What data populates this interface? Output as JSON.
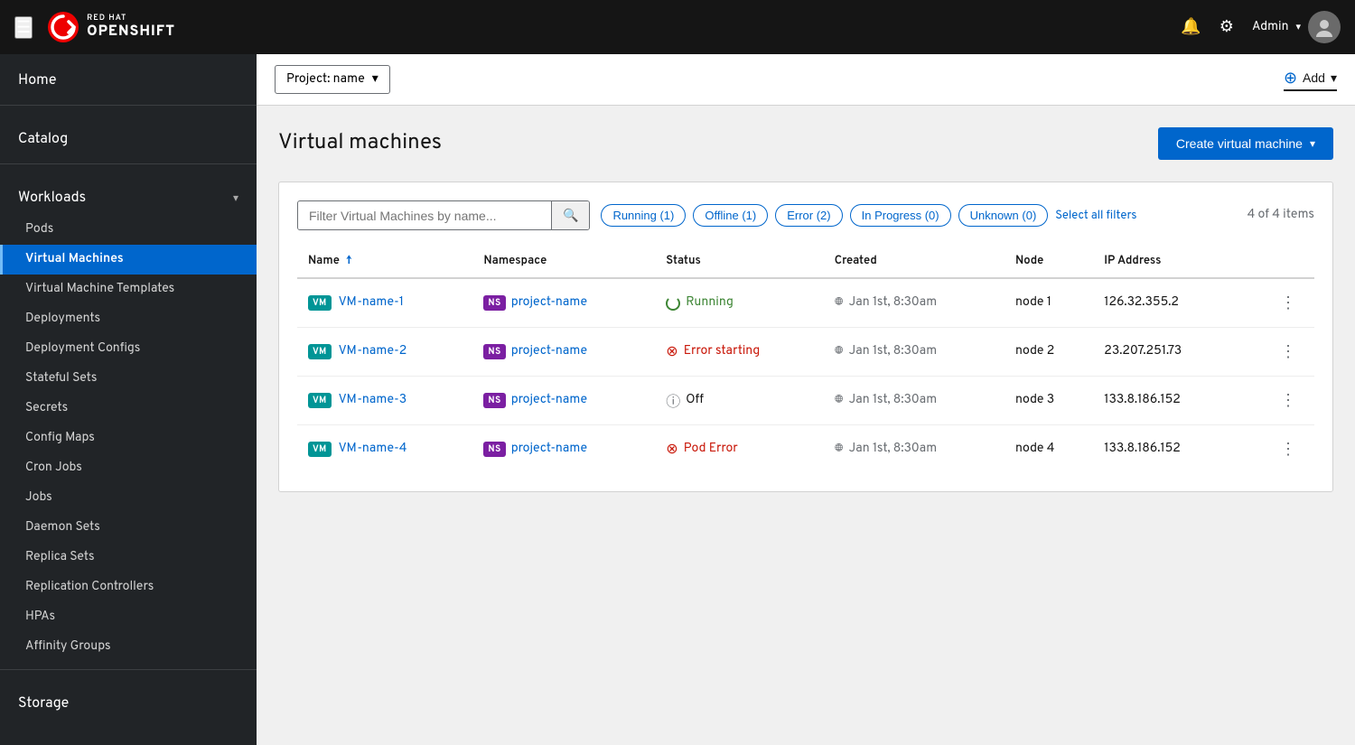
{
  "topnav": {
    "logo_text": "OPENSHIFT",
    "logo_subtext": "RED HAT",
    "user_label": "Admin",
    "user_chevron": "▾"
  },
  "sidebar": {
    "home_label": "Home",
    "catalog_label": "Catalog",
    "workloads_label": "Workloads",
    "workloads_items": [
      {
        "id": "pods",
        "label": "Pods"
      },
      {
        "id": "virtual-machines",
        "label": "Virtual Machines",
        "active": true
      },
      {
        "id": "virtual-machine-templates",
        "label": "Virtual Machine Templates"
      },
      {
        "id": "deployments",
        "label": "Deployments"
      },
      {
        "id": "deployment-configs",
        "label": "Deployment Configs"
      },
      {
        "id": "stateful-sets",
        "label": "Stateful Sets"
      },
      {
        "id": "secrets",
        "label": "Secrets"
      },
      {
        "id": "config-maps",
        "label": "Config Maps"
      },
      {
        "id": "cron-jobs",
        "label": "Cron Jobs"
      },
      {
        "id": "jobs",
        "label": "Jobs"
      },
      {
        "id": "daemon-sets",
        "label": "Daemon Sets"
      },
      {
        "id": "replica-sets",
        "label": "Replica Sets"
      },
      {
        "id": "replication-controllers",
        "label": "Replication Controllers"
      },
      {
        "id": "hpas",
        "label": "HPAs"
      },
      {
        "id": "affinity-groups",
        "label": "Affinity Groups"
      }
    ],
    "storage_label": "Storage"
  },
  "topbar": {
    "project_label": "Project: name",
    "add_label": "Add"
  },
  "page": {
    "title": "Virtual machines",
    "create_button": "Create virtual machine",
    "items_count": "4 of 4 items",
    "search_placeholder": "Filter Virtual Machines by name...",
    "filters": [
      {
        "id": "running",
        "label": "Running (1)"
      },
      {
        "id": "offline",
        "label": "Offline (1)"
      },
      {
        "id": "error",
        "label": "Error (2)"
      },
      {
        "id": "in-progress",
        "label": "In Progress (0)"
      },
      {
        "id": "unknown",
        "label": "Unknown (0)"
      }
    ],
    "select_filters_label": "Select all filters",
    "table": {
      "headers": [
        "Name",
        "Namespace",
        "Status",
        "Created",
        "Node",
        "IP Address"
      ],
      "rows": [
        {
          "vm_badge": "VM",
          "name": "VM-name-1",
          "ns_badge": "NS",
          "namespace": "project-name",
          "status_type": "running",
          "status": "Running",
          "created": "Jan 1st, 8:30am",
          "node": "node 1",
          "ip": "126.32.355.2"
        },
        {
          "vm_badge": "VM",
          "name": "VM-name-2",
          "ns_badge": "NS",
          "namespace": "project-name",
          "status_type": "error",
          "status": "Error starting",
          "created": "Jan 1st, 8:30am",
          "node": "node 2",
          "ip": "23.207.251.73"
        },
        {
          "vm_badge": "VM",
          "name": "VM-name-3",
          "ns_badge": "NS",
          "namespace": "project-name",
          "status_type": "off",
          "status": "Off",
          "created": "Jan 1st, 8:30am",
          "node": "node 3",
          "ip": "133.8.186.152"
        },
        {
          "vm_badge": "VM",
          "name": "VM-name-4",
          "ns_badge": "NS",
          "namespace": "project-name",
          "status_type": "pod-error",
          "status": "Pod Error",
          "created": "Jan 1st, 8:30am",
          "node": "node 4",
          "ip": "133.8.186.152"
        }
      ]
    }
  }
}
